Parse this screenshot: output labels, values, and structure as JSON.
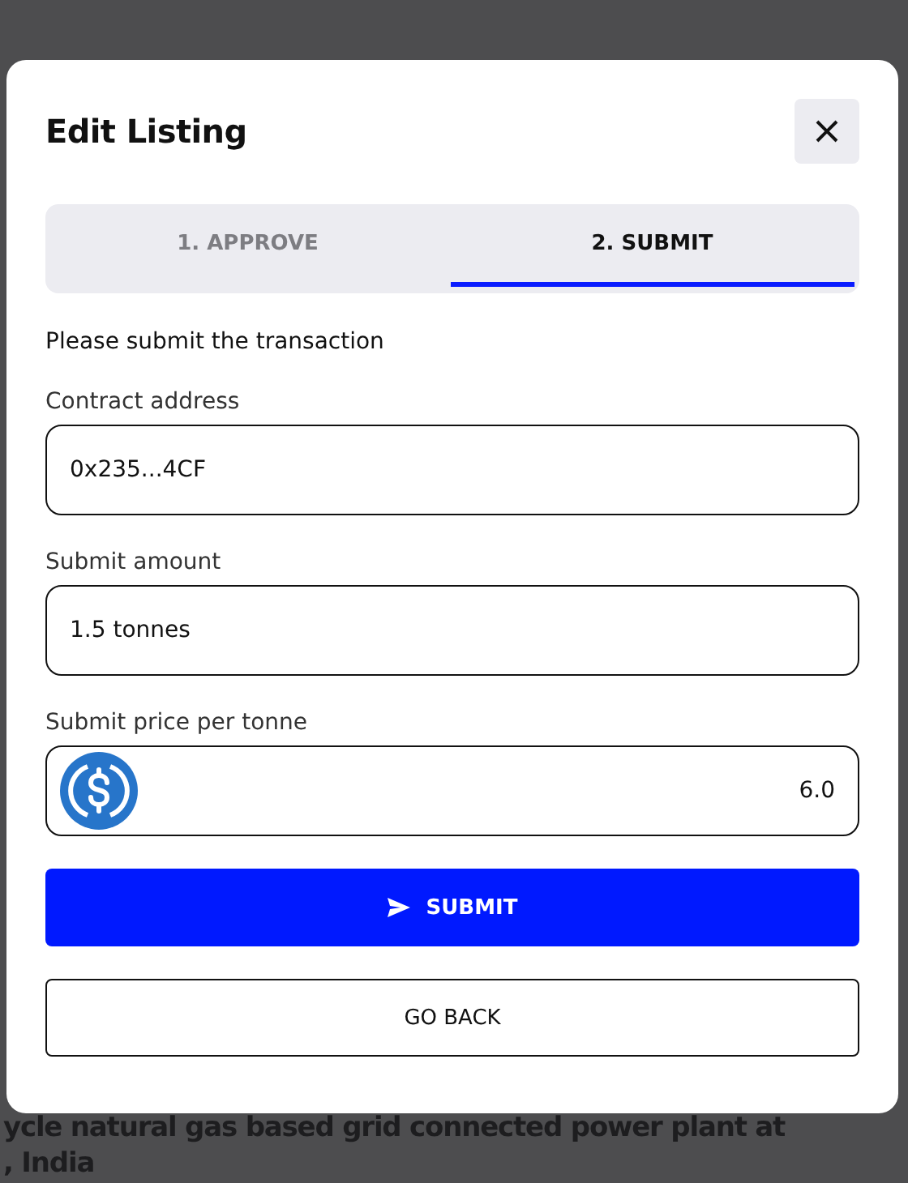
{
  "background": {
    "lines": [
      "ycle natural gas based grid connected power plant at",
      ", India"
    ]
  },
  "dialog": {
    "title": "Edit Listing",
    "tabs": [
      {
        "label": "1. APPROVE",
        "selected": false
      },
      {
        "label": "2. SUBMIT",
        "selected": true
      }
    ],
    "instruction": "Please submit the transaction",
    "fields": [
      {
        "kind": "text",
        "label": "Contract address",
        "value": "0x235...4CF"
      },
      {
        "kind": "text",
        "label": "Submit amount",
        "value": "1.5 tonnes"
      },
      {
        "kind": "currency",
        "label": "Submit price per tonne",
        "value": "6.0"
      }
    ],
    "primary_button": "SUBMIT",
    "secondary_button": "GO BACK"
  }
}
